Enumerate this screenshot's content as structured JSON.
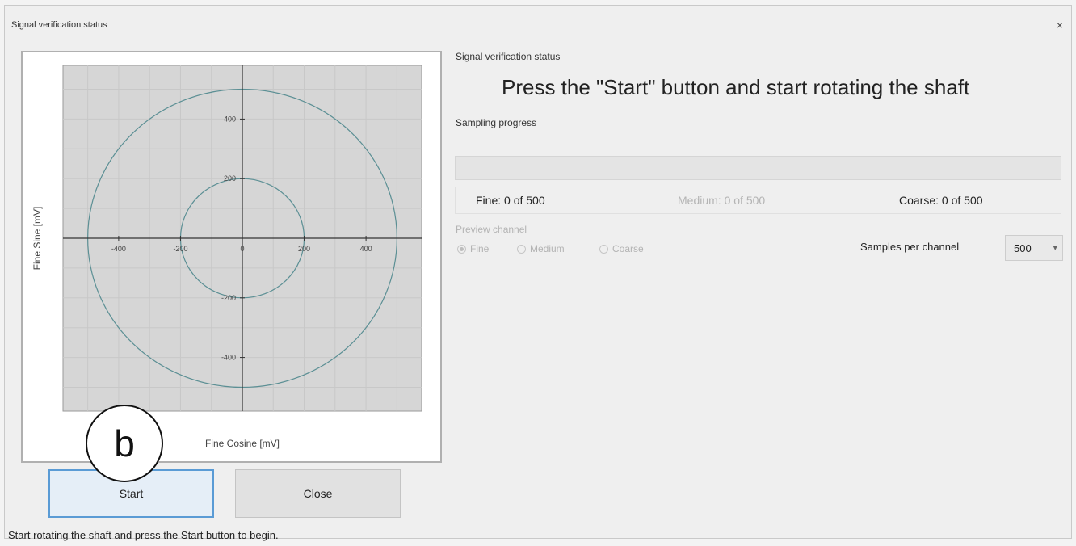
{
  "window": {
    "title": "Signal verification status",
    "close_glyph": "×"
  },
  "status_panel": {
    "group_label": "Signal verification status",
    "instruction": "Press the \"Start\" button and start rotating the shaft",
    "sampling_label": "Sampling progress",
    "progress_fraction": 0,
    "progress_color": "#06b025",
    "fine_count": "Fine: 0 of 500",
    "medium_count": "Medium: 0 of 500",
    "coarse_count": "Coarse: 0 of 500"
  },
  "preview_channel": {
    "label": "Preview channel",
    "options": [
      "Fine",
      "Medium",
      "Coarse"
    ],
    "selected": "Fine"
  },
  "samples_per_channel": {
    "label": "Samples per channel",
    "value": "500"
  },
  "buttons": {
    "start": "Start",
    "close": "Close"
  },
  "status_bar": "Start rotating the shaft and press the Start button to begin.",
  "callout_label": "b",
  "chart_data": {
    "type": "scatter",
    "xlabel": "Fine Cosine [mV]",
    "ylabel": "Fine Sine [mV]",
    "xlim": [
      -580,
      580
    ],
    "ylim": [
      -580,
      580
    ],
    "x_ticks": [
      -400,
      -200,
      0,
      200,
      400
    ],
    "x_tick_labels": [
      "-400",
      "-200",
      "0",
      "200",
      "400"
    ],
    "y_ticks": [
      400,
      200,
      0,
      -200,
      -400
    ],
    "y_tick_labels": [
      "400",
      "200",
      "0",
      "-200",
      "-400"
    ],
    "reference_circles_mv": [
      200,
      500
    ],
    "series": [],
    "grid": true,
    "colors": {
      "plot_bg": "#d6d6d6",
      "circle": "#5b8f94",
      "axis": "#333333"
    }
  }
}
